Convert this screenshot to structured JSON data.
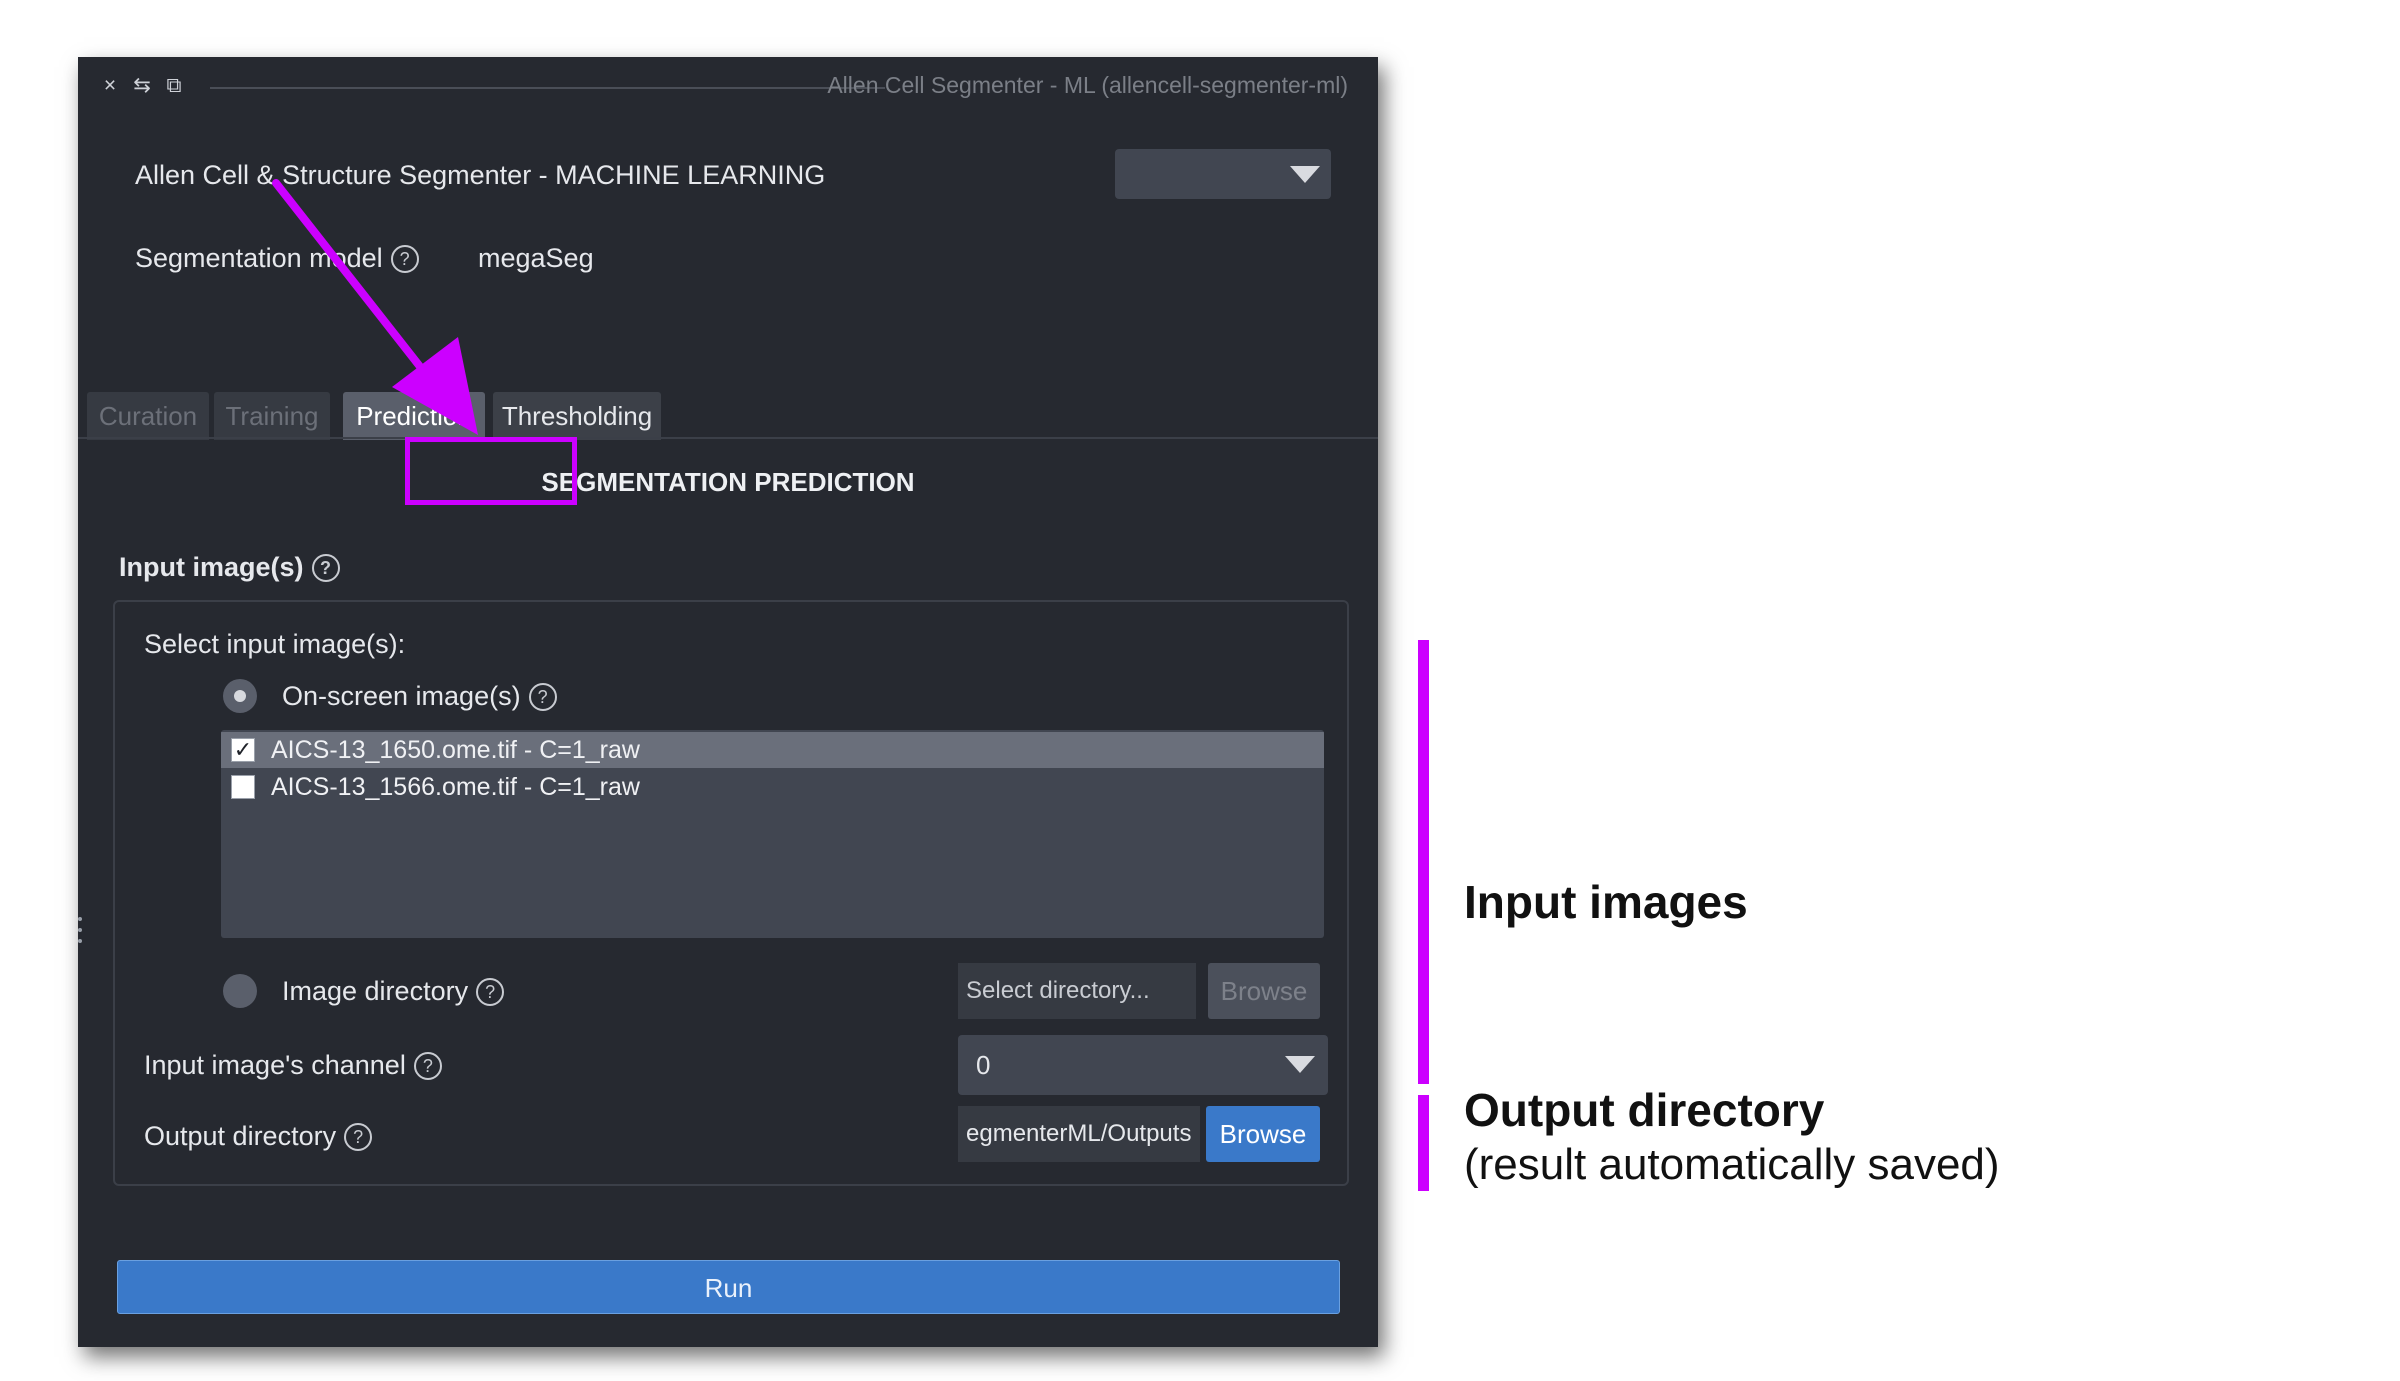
{
  "window": {
    "title": "Allen Cell Segmenter - ML (allencell-segmenter-ml)",
    "controls": [
      "×",
      "⇆",
      "⧉"
    ]
  },
  "header": {
    "app_title": "Allen Cell & Structure Segmenter - MACHINE LEARNING",
    "model_label": "Segmentation model",
    "model_value": "megaSeg",
    "dropdown_value": ""
  },
  "tabs": [
    {
      "label": "Curation",
      "active": false
    },
    {
      "label": "Training",
      "active": false
    },
    {
      "label": "Prediction",
      "active": true
    },
    {
      "label": "Thresholding",
      "active": false
    }
  ],
  "prediction": {
    "section_title": "SEGMENTATION PREDICTION",
    "input_heading": "Input image(s)",
    "select_label": "Select input image(s):",
    "onscreen_label": "On-screen image(s)",
    "images": [
      {
        "label": "AICS-13_1650.ome.tif - C=1_raw",
        "checked": true
      },
      {
        "label": "AICS-13_1566.ome.tif - C=1_raw",
        "checked": false
      }
    ],
    "image_dir_label": "Image directory",
    "image_dir_placeholder": "Select directory...",
    "image_dir_browse": "Browse",
    "channel_label": "Input image's channel",
    "channel_value": "0",
    "output_label": "Output directory",
    "output_value": "egmenterML/Outputs",
    "output_browse": "Browse",
    "run_label": "Run"
  },
  "help_glyph": "?",
  "annotations": {
    "input_images": "Input images",
    "output_heading": "Output directory",
    "output_note": "(result automatically saved)",
    "accent_color": "#cc00ff"
  }
}
